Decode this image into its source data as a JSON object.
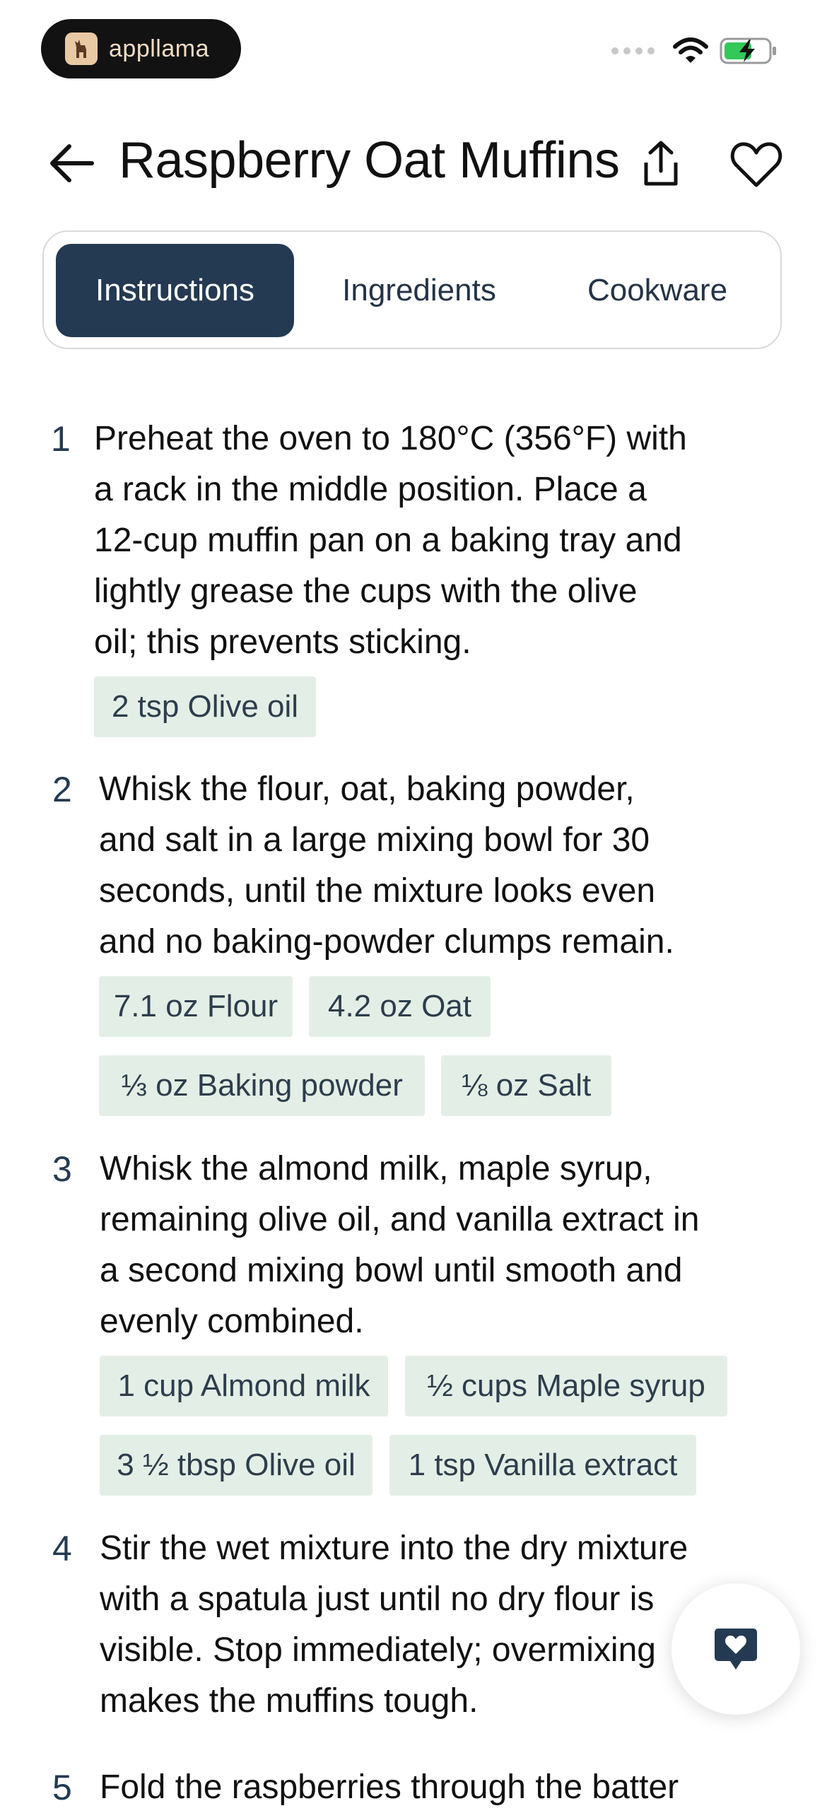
{
  "status_bar": {
    "brand": "appllama",
    "battery_color": "#34c759"
  },
  "header": {
    "title": "Raspberry Oat Muffins"
  },
  "tabs": [
    {
      "label": "Instructions",
      "active": true
    },
    {
      "label": "Ingredients",
      "active": false
    },
    {
      "label": "Cookware",
      "active": false
    }
  ],
  "steps": [
    {
      "number": "1",
      "lines": [
        "Preheat the oven to 180°C (356°F) with",
        "a rack in the middle position. Place a",
        "12-cup muffin pan on a baking tray and",
        "lightly grease the cups with the olive",
        "oil; this prevents sticking."
      ],
      "chips": [
        "2 tsp Olive oil"
      ]
    },
    {
      "number": "2",
      "lines": [
        "Whisk the flour, oat, baking powder,",
        "and salt in a large mixing bowl for 30",
        "seconds, until the mixture looks even",
        "and no baking-powder clumps remain."
      ],
      "chips": [
        "7.1 oz Flour",
        "4.2 oz Oat",
        "⅓ oz Baking powder",
        "⅛ oz Salt"
      ]
    },
    {
      "number": "3",
      "lines": [
        "Whisk the almond milk, maple syrup,",
        "remaining olive oil, and vanilla extract in",
        "a second mixing bowl until smooth and",
        "evenly combined."
      ],
      "chips": [
        "1 cup Almond milk",
        "½ cups Maple syrup",
        "3 ½ tbsp Olive oil",
        "1 tsp Vanilla extract"
      ]
    },
    {
      "number": "4",
      "lines": [
        "Stir the wet mixture into the dry mixture",
        "with a spatula just until no dry flour is",
        "visible. Stop immediately; overmixing",
        "makes the muffins tough."
      ],
      "chips": []
    },
    {
      "number": "5",
      "lines": [
        "Fold the raspberries through the batter"
      ],
      "chips": []
    }
  ],
  "colors": {
    "accent": "#243a52",
    "chip_bg": "#e3efe6",
    "chip_text": "#2e3d4d"
  }
}
